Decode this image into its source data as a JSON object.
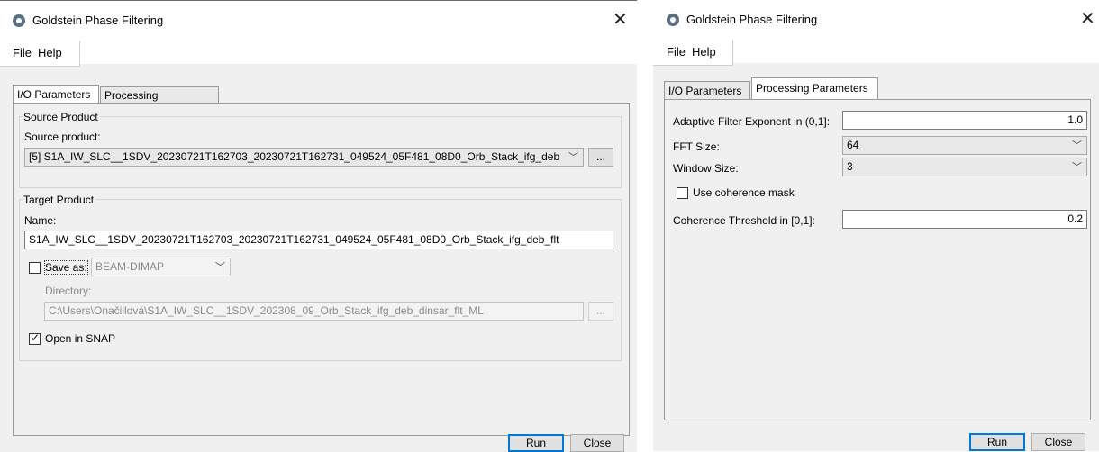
{
  "window1": {
    "title": "Goldstein Phase Filtering",
    "close": "✕",
    "menu": [
      "File",
      "Help"
    ],
    "tabs": [
      "I/O Parameters",
      "Processing Parameters"
    ],
    "source_group_title": "Source Product",
    "source_label": "Source product:",
    "source_value": "[5] S1A_IW_SLC__1SDV_20230721T162703_20230721T162731_049524_05F481_08D0_Orb_Stack_ifg_deb",
    "browse": "...",
    "target_group_title": "Target Product",
    "name_label": "Name:",
    "name_value": "S1A_IW_SLC__1SDV_20230721T162703_20230721T162731_049524_05F481_08D0_Orb_Stack_ifg_deb_flt",
    "save_as_label": "Save as:",
    "save_as_checked": false,
    "format_value": "BEAM-DIMAP",
    "directory_label": "Directory:",
    "directory_value": "C:\\Users\\Onačillová\\S1A_IW_SLC__1SDV_202308_09_Orb_Stack_ifg_deb_dinsar_flt_ML",
    "dir_browse": "...",
    "open_in_snap_label": "Open in SNAP",
    "open_in_snap_checked": true,
    "run": "Run",
    "close_btn": "Close"
  },
  "window2": {
    "title": "Goldstein Phase Filtering",
    "close": "✕",
    "menu": [
      "File",
      "Help"
    ],
    "tabs": [
      "I/O Parameters",
      "Processing Parameters"
    ],
    "params": {
      "exponent_label": "Adaptive Filter Exponent in (0,1]:",
      "exponent_value": "1.0",
      "fft_label": "FFT Size:",
      "fft_value": "64",
      "window_label": "Window Size:",
      "window_value": "3",
      "coherence_mask_label": "Use coherence mask",
      "coherence_mask_checked": false,
      "threshold_label": "Coherence Threshold in [0,1]:",
      "threshold_value": "0.2"
    },
    "run": "Run",
    "close_btn": "Close"
  }
}
